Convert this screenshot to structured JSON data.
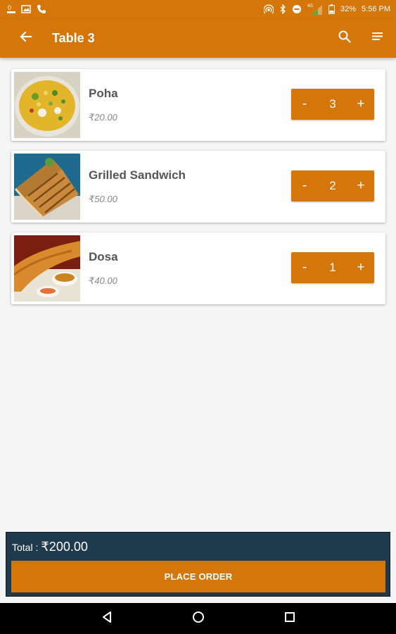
{
  "status_bar": {
    "battery": "32%",
    "time": "5:56 PM",
    "network": "4G"
  },
  "app_bar": {
    "title": "Table 3",
    "icons": [
      "back-arrow-icon",
      "search-icon",
      "sort-icon"
    ]
  },
  "items": [
    {
      "name": "Poha",
      "price": "₹20.00",
      "quantity": "3",
      "minus": "-",
      "plus": "+"
    },
    {
      "name": "Grilled Sandwich",
      "price": "₹50.00",
      "quantity": "2",
      "minus": "-",
      "plus": "+"
    },
    {
      "name": "Dosa",
      "price": "₹40.00",
      "quantity": "1",
      "minus": "-",
      "plus": "+"
    }
  ],
  "footer": {
    "total_label": "Total :",
    "total_amount": "₹200.00",
    "place_order_label": "PLACE ORDER"
  },
  "colors": {
    "primary": "#d5760a",
    "footer_bg": "#1f3a4d",
    "background": "#f5f5f5"
  }
}
